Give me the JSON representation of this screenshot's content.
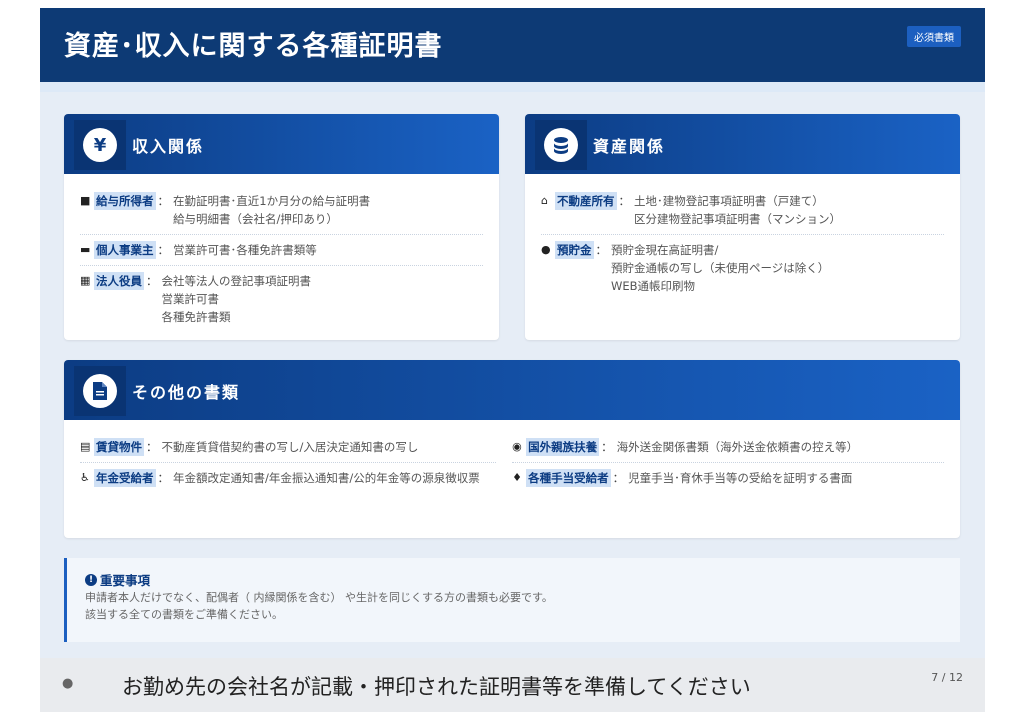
{
  "header": {
    "title": "資産･収入に関する各種証明書",
    "badge": "必須書類"
  },
  "income": {
    "icon": "yen-icon",
    "title": "収入関係",
    "rows": [
      {
        "icon": "briefcase-icon",
        "label": "給与所得者",
        "sep": "：",
        "values": [
          "在勤証明書･直近1か月分の給与証明書",
          "給与明細書（会社名/押印あり）"
        ]
      },
      {
        "icon": "wallet-icon",
        "label": "個人事業主",
        "sep": "：",
        "values": [
          "営業許可書･各種免許書類等"
        ]
      },
      {
        "icon": "building-icon",
        "label": "法人役員",
        "sep": "：",
        "values": [
          "会社等法人の登記事項証明書",
          "営業許可書",
          "各種免許書類"
        ]
      }
    ]
  },
  "assets": {
    "icon": "coins-icon",
    "title": "資産関係",
    "rows": [
      {
        "icon": "home-icon",
        "label": "不動産所有",
        "sep": "：",
        "values": [
          "土地･建物登記事項証明書（戸建て）",
          "区分建物登記事項証明書（マンション）"
        ]
      },
      {
        "icon": "piggy-bank-icon",
        "label": "預貯金",
        "sep": "：",
        "values": [
          "預貯金現在高証明書/",
          "預貯金通帳の写し（未使用ページは除く）",
          "WEB通帳印刷物"
        ]
      }
    ]
  },
  "other": {
    "icon": "document-icon",
    "title": "その他の書類",
    "left": [
      {
        "icon": "contract-icon",
        "label": "賃貸物件",
        "sep": "：",
        "values": [
          "不動産賃貸借契約書の写し/入居決定通知書の写し"
        ]
      },
      {
        "icon": "pension-icon",
        "label": "年金受給者",
        "sep": "：",
        "values": [
          "年金額改定通知書/年金振込通知書/公的年金等の源泉徴収票"
        ]
      }
    ],
    "right": [
      {
        "icon": "globe-icon",
        "label": "国外親族扶養",
        "sep": "：",
        "values": [
          "海外送金関係書類（海外送金依頼書の控え等）"
        ]
      },
      {
        "icon": "child-icon",
        "label": "各種手当受給者",
        "sep": "：",
        "values": [
          "児童手当･育休手当等の受給を証明する書面"
        ]
      }
    ]
  },
  "notice": {
    "icon": "exclamation-icon",
    "title": "重要事項",
    "lines": [
      "申請者本人だけでなく、配偶者（ 内縁関係を含む） や生計を同じくする方の書類も必要です。",
      "該当する全ての書類をご準備ください。"
    ]
  },
  "footer": {
    "icon": "lightbulb-icon",
    "caption": "お勤め先の会社名が記載・押印された証明書等を準備してください",
    "page": "7 / 12"
  }
}
